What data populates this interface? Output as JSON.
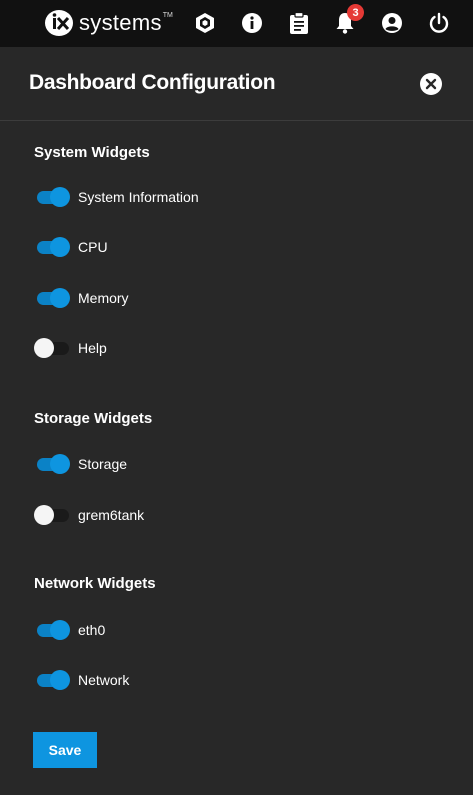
{
  "topbar": {
    "logo_text": "systems",
    "logo_tm": "TM",
    "notification_count": "3",
    "icons": [
      "truecommand-icon",
      "info-icon",
      "clipboard-icon",
      "bell-icon",
      "account-circle-icon",
      "power-icon"
    ]
  },
  "panel": {
    "title": "Dashboard Configuration",
    "save_label": "Save"
  },
  "sections": {
    "system": {
      "title": "System Widgets",
      "items": [
        {
          "label": "System Information",
          "enabled": true
        },
        {
          "label": "CPU",
          "enabled": true
        },
        {
          "label": "Memory",
          "enabled": true
        },
        {
          "label": "Help",
          "enabled": false
        }
      ]
    },
    "storage": {
      "title": "Storage Widgets",
      "items": [
        {
          "label": "Storage",
          "enabled": true
        },
        {
          "label": "grem6tank",
          "enabled": false
        }
      ]
    },
    "network": {
      "title": "Network Widgets",
      "items": [
        {
          "label": "eth0",
          "enabled": true
        },
        {
          "label": "Network",
          "enabled": true
        }
      ]
    }
  },
  "colors": {
    "topbar_bg": "#111111",
    "panel_bg": "#282828",
    "accent": "#0e95e0",
    "badge": "#e53935"
  }
}
